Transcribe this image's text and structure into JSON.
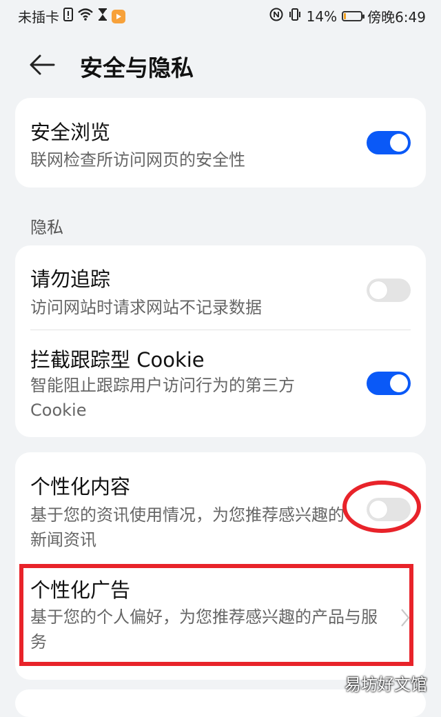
{
  "status_bar": {
    "carrier": "未插卡",
    "battery_percent": "14%",
    "battery_level": 0.14,
    "time": "傍晚6:49"
  },
  "header": {
    "title": "安全与隐私"
  },
  "safe_browsing": {
    "title": "安全浏览",
    "subtitle": "联网检查所访问网页的安全性",
    "enabled": true
  },
  "privacy": {
    "section_label": "隐私",
    "do_not_track": {
      "title": "请勿追踪",
      "subtitle": "访问网站时请求网站不记录数据",
      "enabled": false
    },
    "block_cookie": {
      "title": "拦截跟踪型 Cookie",
      "subtitle": "智能阻止跟踪用户访问行为的第三方Cookie",
      "enabled": true
    }
  },
  "personalization": {
    "content": {
      "title": "个性化内容",
      "subtitle": "基于您的资讯使用情况，为您推荐感兴趣的新闻资讯",
      "enabled": false
    },
    "ads": {
      "title": "个性化广告",
      "subtitle": "基于您的个人偏好，为您推荐感兴趣的产品与服务"
    }
  },
  "colors": {
    "accent": "#0a59f7",
    "annotation": "#e8232a"
  },
  "watermark": "易坊好文馆"
}
